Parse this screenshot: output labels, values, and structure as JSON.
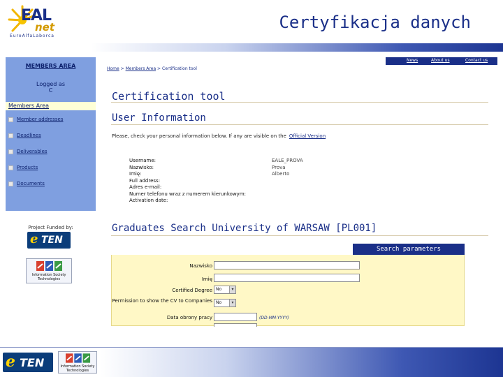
{
  "slide": {
    "title": "Certyfikacja danych",
    "logo": {
      "brand": "EAL",
      "brand_sub": "net",
      "tagline": "EuroAlfaLaborca"
    }
  },
  "sidebar": {
    "members_area_heading": "MEMBERS AREA",
    "logged_as_label": "Logged as",
    "logged_user": "C",
    "members_tab": "Members Area",
    "items": [
      {
        "label": "Member addresses"
      },
      {
        "label": "Deadlines"
      },
      {
        "label": "Deliverables"
      },
      {
        "label": "Products"
      },
      {
        "label": "Documents"
      }
    ],
    "funded_label": "Project Funded by:",
    "eten_logo": {
      "e": "e",
      "ten": "TEN"
    },
    "ist_logo_text": "Information Society Technologies"
  },
  "topnav": {
    "news": "News",
    "about": "About us",
    "contact": "Contact us"
  },
  "breadcrumb": {
    "home": "Home",
    "sep": ">",
    "members": "Members Area",
    "current": "Certification tool"
  },
  "page": {
    "heading": "Certification tool"
  },
  "user_info": {
    "heading": "User Information",
    "notice": "Please, check your personal information below. If any are visible on the",
    "notice_link": "Official Version",
    "fields": [
      {
        "key": "Username:",
        "value": "EALE_PROVA"
      },
      {
        "key": "Nazwisko:",
        "value": "Prova"
      },
      {
        "key": "Imię:",
        "value": "Alberto"
      },
      {
        "key": "Full address:",
        "value": ""
      },
      {
        "key": "Adres e-mail:",
        "value": ""
      },
      {
        "key": "Numer telefonu wraz z numerem kierunkowym:",
        "value": ""
      },
      {
        "key": "Activation date:",
        "value": ""
      }
    ]
  },
  "graduates": {
    "heading": "Graduates Search University of WARSAW [PL001]",
    "search_tab": "Search parameters",
    "fields": {
      "nazwisko_label": "Nazwisko",
      "imie_label": "Imię",
      "certified_degree_label": "Certified Degree",
      "certified_degree_value": "No",
      "permission_label": "Permission to show the CV to Companies",
      "permission_value": "No",
      "date_label": "Data obrony pracy",
      "date_hint": "(DD-MM-YYYY)"
    }
  },
  "footer": {
    "eten_logo": {
      "e": "e",
      "ten": "TEN"
    },
    "ist_logo_text": "Information Society Technologies"
  },
  "colors": {
    "navy": "#1a2f88",
    "sidebar": "#7f9fe0",
    "panel": "#fff8c6",
    "accent_gold": "#d39a00"
  }
}
